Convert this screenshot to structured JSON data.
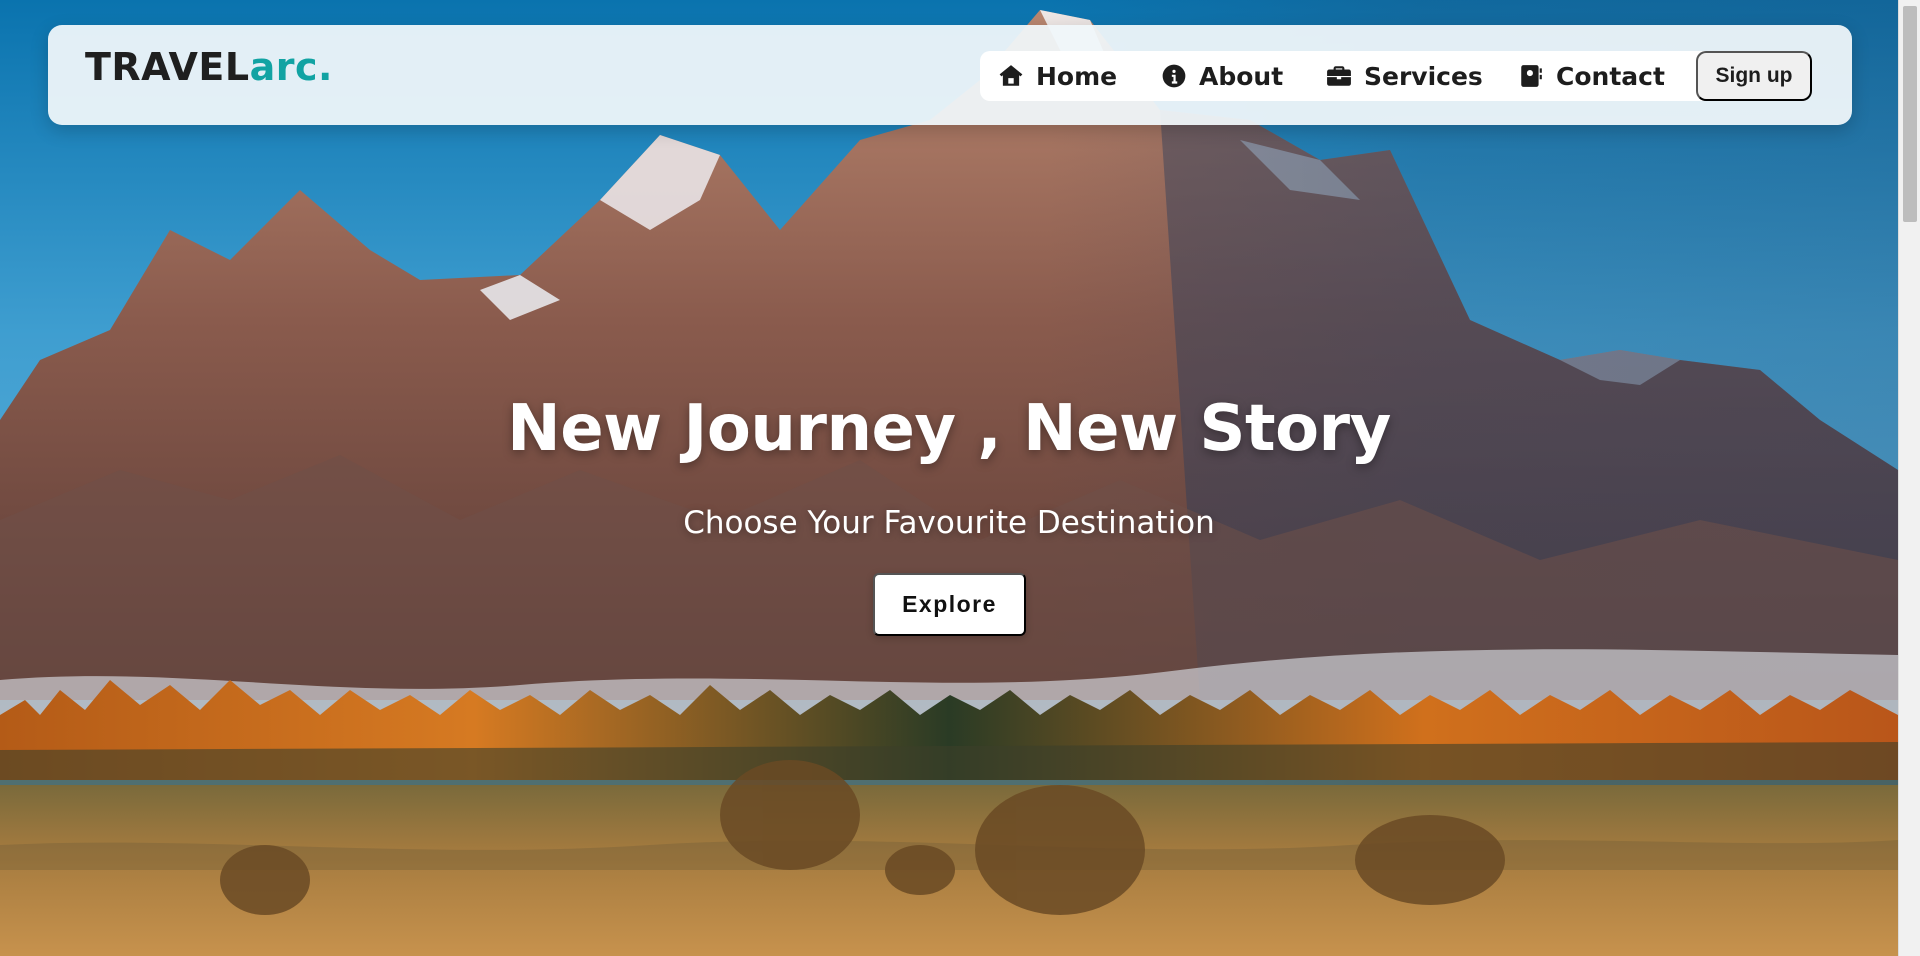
{
  "brand": {
    "name_main": "TRAVEL",
    "name_accent": "arc.",
    "accent_color": "#12a3a3"
  },
  "nav": {
    "items": [
      {
        "label": "Home",
        "icon": "home-icon"
      },
      {
        "label": "About",
        "icon": "info-icon"
      },
      {
        "label": "Services",
        "icon": "briefcase-icon"
      },
      {
        "label": "Contact",
        "icon": "contact-book-icon"
      }
    ],
    "signup_label": "Sign up"
  },
  "hero": {
    "title": "New Journey , New Story",
    "subtitle": "Choose Your Favourite Destination",
    "cta_label": "Explore",
    "background": "mountain-landscape-image"
  }
}
